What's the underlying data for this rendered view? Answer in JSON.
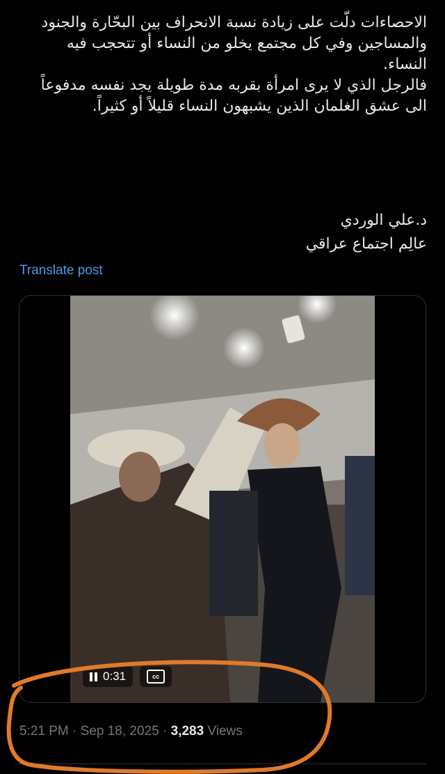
{
  "post": {
    "paragraph_1": "الاحصاءات دلّت على زيادة نسبة الانحراف بين البحّارة والجنود والمساجين وفي كل مجتمع يخلو من النساء أو تتحجب فيه النساء.",
    "paragraph_2": "فالرجل الذي لا يرى امرأة بقربه مدة طويلة يجد نفسه مدفوعاً الى عشق الغلمان الذين يشبهون النساء قليلاً أو كثيراً.",
    "author_line": "د.علي الوردي",
    "author_title": "عالِم اجتماع عراقي"
  },
  "translate_label": "Translate post",
  "video": {
    "elapsed_time": "0:31",
    "cc_label": "cc"
  },
  "meta": {
    "time": "5:21 PM",
    "separator": "·",
    "date": "Sep 18, 2025",
    "views_count": "3,283",
    "views_label": "Views"
  },
  "colors": {
    "background": "#000000",
    "text": "#e7e9ea",
    "link": "#4a9be8",
    "muted": "#71767b",
    "annotation": "#e07a2a"
  }
}
